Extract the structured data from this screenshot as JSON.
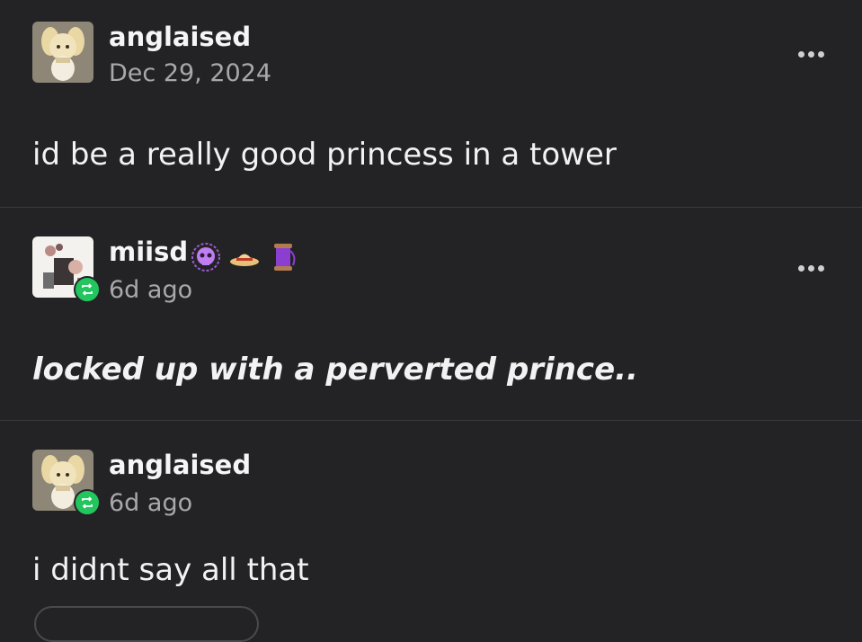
{
  "posts": [
    {
      "username": "anglaised",
      "timestamp": "Dec 29, 2024",
      "text": "id be a really good princess in a tower",
      "reblog": false
    },
    {
      "username": "miisd",
      "timestamp": "6d ago",
      "text": "locked up with a perverted prince..",
      "reblog": true,
      "badges": [
        "purple-skull-badge",
        "straw-hat-badge",
        "thread-spool-badge"
      ]
    },
    {
      "username": "anglaised",
      "timestamp": "6d ago",
      "text": "i didnt say all that",
      "reblog": true
    }
  ],
  "colors": {
    "background": "#232326",
    "reblog_green": "#22c55e",
    "secondary_text": "#a8a8ac"
  }
}
